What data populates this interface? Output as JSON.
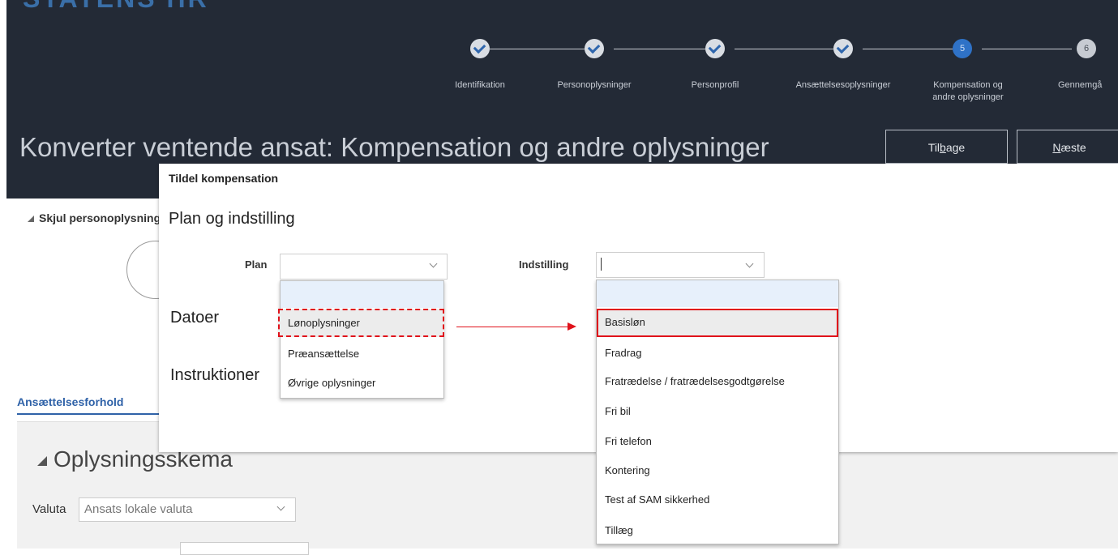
{
  "app": {
    "brand": "STATENS HR"
  },
  "train": {
    "steps": [
      {
        "label": "Identifikation",
        "status": "done"
      },
      {
        "label": "Personoplysninger",
        "status": "done"
      },
      {
        "label": "Personprofil",
        "status": "done"
      },
      {
        "label": "Ansættelsesoplysninger",
        "status": "done"
      },
      {
        "label_line1": "Kompensation og",
        "label_line2": "andre oplysninger",
        "number": "5",
        "status": "current"
      },
      {
        "label": "Gennemgå",
        "number": "6",
        "status": "todo"
      }
    ]
  },
  "page": {
    "title": "Konverter ventende ansat: Kompensation og andre oplysninger",
    "back_label_pre": "Til",
    "back_label_u": "b",
    "back_label_post": "age",
    "next_label_u": "N",
    "next_label_post": "æste"
  },
  "background": {
    "hide_toggle": "Skjul personoplysninger",
    "tab_label": "Ansættelsesforhold",
    "section_title": "Oplysningsskema",
    "currency_label": "Valuta",
    "currency_value": "Ansats lokale valuta"
  },
  "dialog": {
    "title": "Tildel kompensation",
    "section_plan": "Plan og indstilling",
    "section_dates": "Datoer",
    "section_instructions": "Instruktioner",
    "plan_label": "Plan",
    "plan_value": "",
    "setting_label": "Indstilling",
    "setting_value": "",
    "plan_options": [
      "Lønoplysninger",
      "Præansættelse",
      "Øvrige oplysninger"
    ],
    "setting_options": [
      "Basisløn",
      "Fradrag",
      "Fratrædelse / fratrædelsesgodtgørelse",
      "Fri bil",
      "Fri telefon",
      "Kontering",
      "Test af SAM sikkerhed",
      "Tillæg"
    ]
  },
  "colors": {
    "header_bg": "#232a36",
    "accent": "#2f72c7",
    "highlight": "#e0121b",
    "link": "#2f62a8"
  }
}
